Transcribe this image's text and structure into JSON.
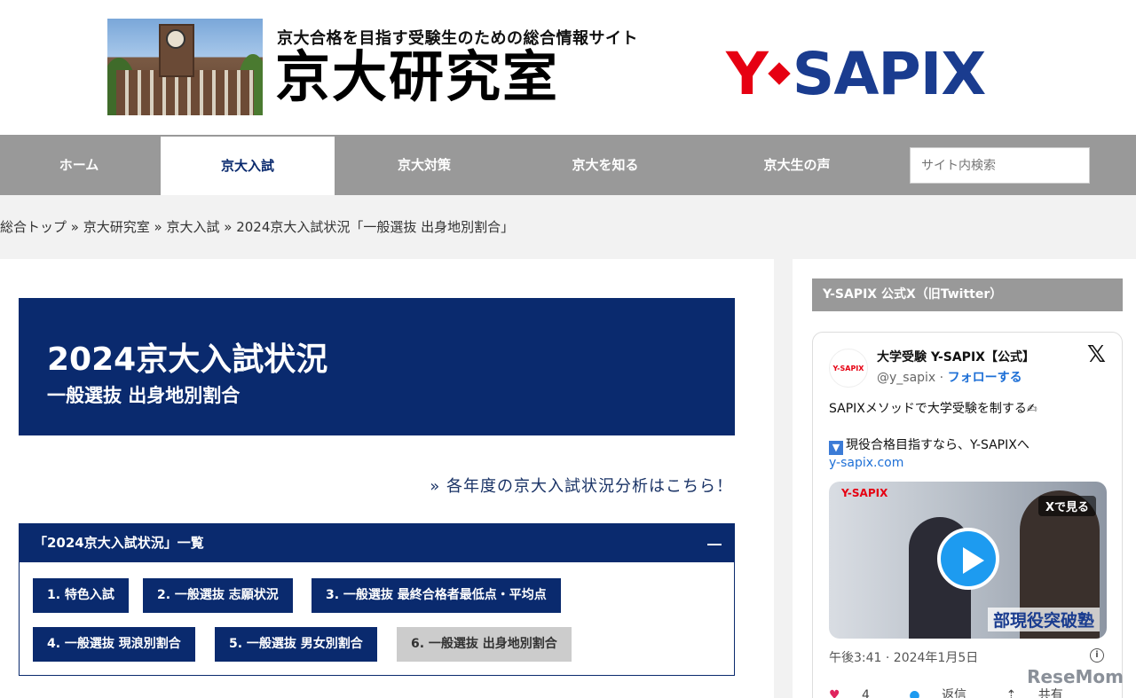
{
  "header": {
    "tagline": "京大合格を目指す受験生のための総合情報サイト",
    "site_title": "京大研究室",
    "logo_y": "Y",
    "logo_rest": "SAPIX"
  },
  "nav": {
    "items": [
      "ホーム",
      "京大入試",
      "京大対策",
      "京大を知る",
      "京大生の声"
    ],
    "active": "京大入試",
    "search_placeholder": "サイト内検索"
  },
  "breadcrumb": {
    "items": [
      "総合トップ",
      "京大研究室",
      "京大入試"
    ],
    "current": "2024京大入試状況「一般選抜 出身地別割合」",
    "separator": " » "
  },
  "hero": {
    "title": "2024京大入試状況",
    "subtitle": "一般選抜 出身地別割合"
  },
  "more_link": "» 各年度の京大入試状況分析はこちら！",
  "toc": {
    "heading": "「2024京大入試状況」一覧",
    "chips": [
      "1. 特色入試",
      "2. 一般選抜 志願状況",
      "3. 一般選抜 最終合格者最低点・平均点",
      "4. 一般選抜 現浪別割合",
      "5. 一般選抜 男女別割合",
      "6. 一般選抜 出身地別割合"
    ]
  },
  "sidebar": {
    "heading": "Y-SAPIX 公式X（旧Twitter）",
    "tweet": {
      "avatar_text": "Y-SAPIX",
      "name": "大学受験 Y-SAPIX【公式】",
      "handle": "@y_sapix · ",
      "follow": "フォローする",
      "x_logo": "𝕏",
      "text": "SAPIXメソッドで大学受験を制する✍",
      "line2_icon": "▼",
      "line2": "現役合格目指すなら、Y-SAPIXへ",
      "link": "y-sapix.com",
      "media_brand_y": "Y-",
      "media_brand": "SAPIX",
      "media_see": "Xで見る",
      "media_caption": "部現役突破塾",
      "time": "午後3:41 · 2024年1月5日",
      "info": "i",
      "likes": "4",
      "reply": "返信",
      "share": "共有"
    }
  },
  "watermark": "ReseMom",
  "colors": {
    "navy": "#0a2a6e",
    "nav_gray": "#999999",
    "brand_red": "#e60012",
    "brand_blue": "#1a3c8f",
    "link_blue": "#1d6fd6"
  }
}
